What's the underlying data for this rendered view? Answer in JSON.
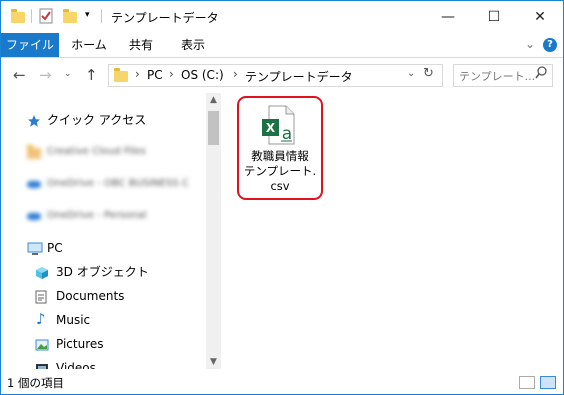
{
  "window": {
    "title": "テンプレートデータ"
  },
  "titlebar": {
    "minimize_label": "—",
    "maximize_label": "☐",
    "close_label": "✕"
  },
  "ribbon": {
    "tabs": [
      "ファイル",
      "ホーム",
      "共有",
      "表示"
    ],
    "help_label": "?"
  },
  "address": {
    "crumbs": [
      "PC",
      "OS (C:)",
      "テンプレートデータ"
    ],
    "search_placeholder": "テンプレート..."
  },
  "nav": {
    "quick_access": "クイック アクセス",
    "blurred_items": [
      "Creative Cloud Files",
      "OneDrive - OBC BUSINESS C",
      "OneDrive - Personal"
    ],
    "pc": "PC",
    "pc_items": [
      "3D オブジェクト",
      "Documents",
      "Music",
      "Pictures",
      "Videos"
    ]
  },
  "content": {
    "file_name_line1": "教職員情報",
    "file_name_line2": "テンプレート.",
    "file_name_line3": "csv"
  },
  "status": {
    "item_count": "1 個の項目"
  },
  "colors": {
    "accent": "#1979ca",
    "highlight_border": "#e0121f",
    "excel_green": "#1e7145"
  }
}
